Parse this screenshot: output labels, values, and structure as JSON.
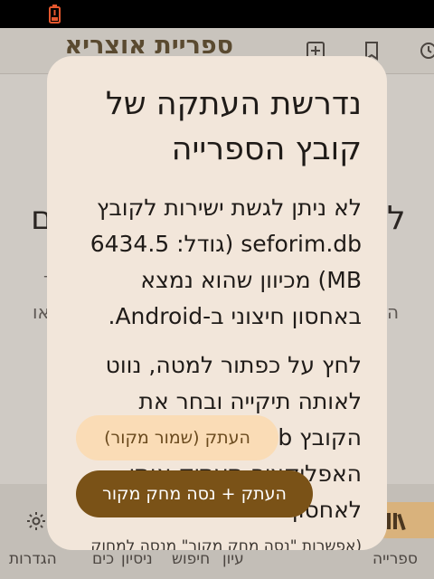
{
  "status_bar": {
    "battery_icon": "battery-low-icon",
    "battery_color": "#e4572e"
  },
  "app": {
    "title": "ספריית אוצריא",
    "appbar_icons": [
      "add-box-icon",
      "bookmark-icon",
      "history-icon"
    ],
    "background_heading_left": "ם",
    "background_heading_right": "ל",
    "background_text_1": "ר",
    "background_text_2": "או",
    "background_text_3": "ה",
    "nav": {
      "settings_label": "הגדרות",
      "settings_icon": "gear-icon",
      "library_label": "ספרייה",
      "library_icon": "library-books-icon",
      "partial_labels": [
        "כים",
        "עיון",
        "חיפוש",
        "ניסיון"
      ]
    }
  },
  "dialog": {
    "title": "נדרשת העתקה של קובץ הספרייה",
    "paragraph_1": "לא ניתן לגשת ישירות לקובץ seforim.db (גודל: 6434.5 MB) מכיוון שהוא נמצא באחסון חיצוני ב-Android.",
    "paragraph_2": "לחץ על כפתור למטה, נווט לאותה תיקייה ובחר את הקובץ seforim.db. האפליקציה תעתיק אותו לאחסון הפנימי.",
    "button_keep_label": "העתק (שמור מקור)",
    "button_delete_label": "העתק + נסה מחק מקור",
    "footnote": "(אפשרות \"נסה מחק מקור\" מנסה למחוק לאחר העתקה, עשויה שלא להצליח)"
  },
  "colors": {
    "dialog_bg": "#f2e6da",
    "primary": "#7a5217",
    "tonal": "#fadcb6",
    "nav_indicator": "#d9b27c"
  }
}
